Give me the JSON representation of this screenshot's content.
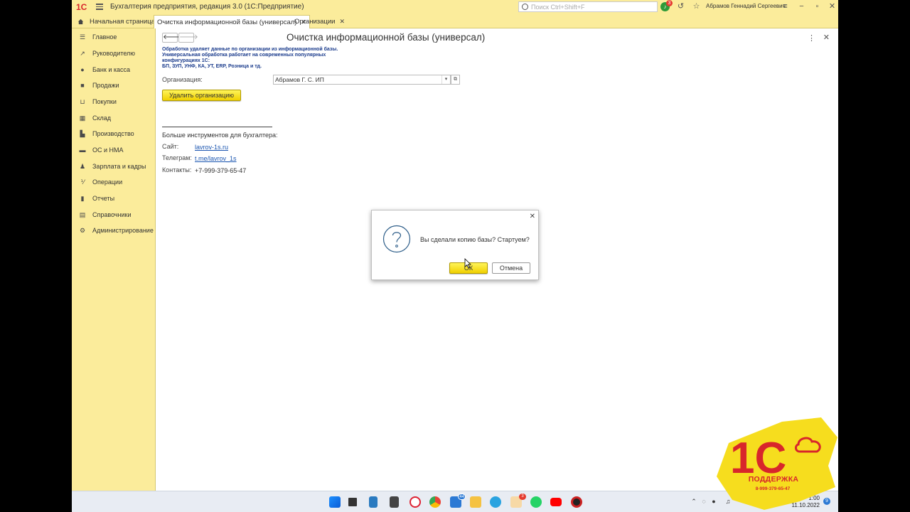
{
  "titlebar": {
    "logo": "1С",
    "title": "Бухгалтерия предприятия, редакция 3.0  (1С:Предприятие)",
    "search_placeholder": "Поиск Ctrl+Shift+F",
    "notifications_count": "3",
    "user": "Абрамов Геннадий Сергеевич"
  },
  "tabs": [
    {
      "label": "Начальная страница"
    },
    {
      "label": "Очистка информационной базы (универсал)"
    },
    {
      "label": "Организации"
    }
  ],
  "sidebar": {
    "items": [
      {
        "label": "Главное",
        "icon": "menu-icon"
      },
      {
        "label": "Руководителю",
        "icon": "trend-icon"
      },
      {
        "label": "Банк и касса",
        "icon": "ruble-icon"
      },
      {
        "label": "Продажи",
        "icon": "bag-icon"
      },
      {
        "label": "Покупки",
        "icon": "cart-icon"
      },
      {
        "label": "Склад",
        "icon": "warehouse-icon"
      },
      {
        "label": "Производство",
        "icon": "factory-icon"
      },
      {
        "label": "ОС и НМА",
        "icon": "truck-icon"
      },
      {
        "label": "Зарплата и кадры",
        "icon": "people-icon"
      },
      {
        "label": "Операции",
        "icon": "operations-icon"
      },
      {
        "label": "Отчеты",
        "icon": "chart-icon"
      },
      {
        "label": "Справочники",
        "icon": "books-icon"
      },
      {
        "label": "Администрирование",
        "icon": "gear-icon"
      }
    ]
  },
  "form": {
    "title": "Очистка информационной базы (универсал)",
    "info_lines": [
      "Обработка удаляет данные по организации из информационной базы.",
      "Универсальная обработка работает на современных популярных",
      "конфигурациях 1С:",
      "БП, ЗУП, УНФ, КА, УТ, ERP, Розница и тд."
    ],
    "org_label": "Организация:",
    "org_value": "Абрамов Г. С. ИП",
    "delete_button": "Удалить организацию",
    "more_tools": "Больше инструментов для бухгалтера:",
    "site_label": "Сайт:",
    "site_link": "lavrov-1s.ru",
    "telegram_label": "Телеграм:",
    "telegram_link": "t.me/lavrov_1s",
    "contacts_label": "Контакты:",
    "contacts_value": "+7-999-379-65-47"
  },
  "dialog": {
    "message": "Вы сделали копию базы? Стартуем?",
    "ok": "ОК",
    "cancel": "Отмена"
  },
  "taskbar": {
    "badges": [
      "44",
      "3"
    ],
    "time": "1:00",
    "date": "11.10.2022",
    "notif": "9"
  },
  "watermark": {
    "logo": "1С",
    "label": "ПОДДЕРЖКА",
    "phone": "8-999-379-65-47"
  },
  "colors": {
    "accent_yellow": "#fbec9b",
    "button_yellow": "#f5dc00",
    "link_blue": "#1a55b0",
    "info_blue": "#1a3b8c",
    "brand_red": "#d8262b"
  }
}
